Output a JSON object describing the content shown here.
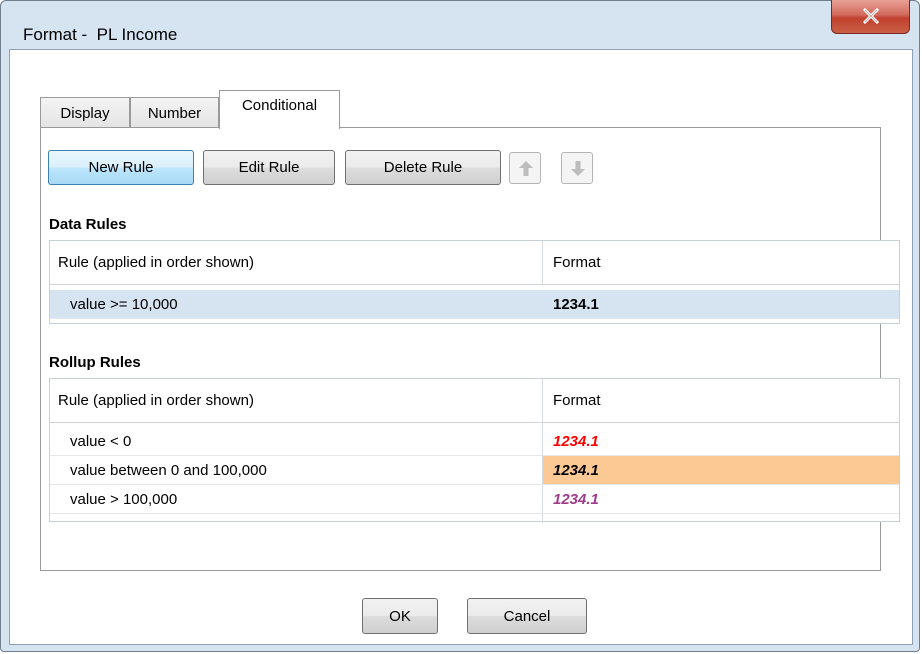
{
  "window": {
    "title": "Format -  PL Income"
  },
  "tabs": [
    {
      "label": "Display"
    },
    {
      "label": "Number"
    },
    {
      "label": "Conditional",
      "active": true
    }
  ],
  "toolbar": {
    "new_rule": "New Rule",
    "edit_rule": "Edit Rule",
    "delete_rule": "Delete Rule",
    "move_up_icon": "arrow-up-icon",
    "move_down_icon": "arrow-down-icon"
  },
  "data_rules": {
    "title": "Data Rules",
    "columns": [
      "Rule (applied in order shown)",
      "Format"
    ],
    "rows": [
      {
        "rule": "value >= 10,000",
        "format": "1234.1",
        "format_color": "#000000",
        "italic": false,
        "background": "#d6e4f2",
        "selected": true
      }
    ]
  },
  "rollup_rules": {
    "title": "Rollup Rules",
    "columns": [
      "Rule (applied in order shown)",
      "Format"
    ],
    "rows": [
      {
        "rule": "value < 0",
        "format": "1234.1",
        "format_color": "#ff0000",
        "italic": true,
        "background": "#ffffff"
      },
      {
        "rule": "value between 0 and 100,000",
        "format": "1234.1",
        "format_color": "#000000",
        "italic": true,
        "background": "#fcc894"
      },
      {
        "rule": "value > 100,000",
        "format": "1234.1",
        "format_color": "#a03a8a",
        "italic": true,
        "background": "#ffffff"
      }
    ]
  },
  "footer": {
    "ok": "OK",
    "cancel": "Cancel"
  },
  "colors": {
    "frame": "#d6e3f1",
    "close_button": "#c9503c",
    "selected_row": "#d6e4f2"
  }
}
